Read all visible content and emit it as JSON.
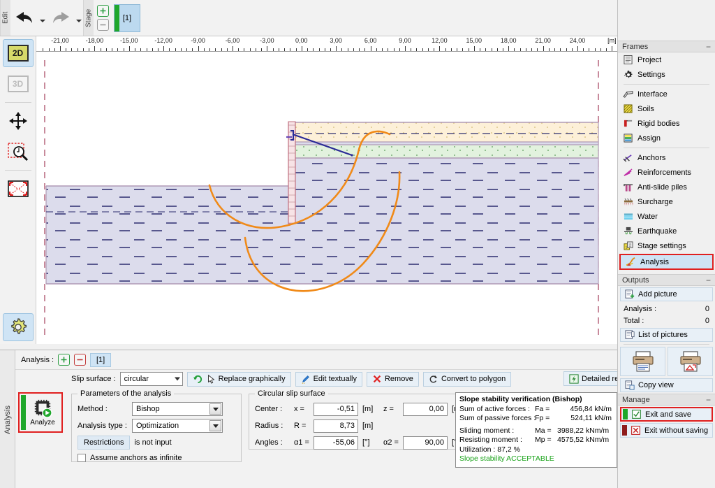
{
  "toolbar": {
    "edit_label": "Edit",
    "stage_label": "Stage",
    "undo_icon": "undo-arrow-icon",
    "redo_icon": "redo-arrow-icon",
    "stage_add_icon": "plus-icon",
    "stage_remove_icon": "minus-icon",
    "stage_tab_label": "[1]"
  },
  "left_tools": [
    {
      "name": "view-2d",
      "label": "2D",
      "active": true
    },
    {
      "name": "view-3d",
      "label": "3D",
      "active": false
    },
    {
      "name": "pan-tool",
      "label": "",
      "active": false
    },
    {
      "name": "zoom-window-tool",
      "label": "",
      "active": false
    },
    {
      "name": "zoom-fit-tool",
      "label": "",
      "active": false
    },
    {
      "name": "settings-tool",
      "label": "",
      "active": true
    }
  ],
  "ruler": {
    "unit": "[m]",
    "labels": [
      "-21,00",
      "-18,00",
      "-15,00",
      "-12,00",
      "-9,00",
      "-6,00",
      "-3,00",
      "0,00",
      "3,00",
      "6,00",
      "9,00",
      "12,00",
      "15,00",
      "18,00",
      "21,00",
      "24,00"
    ]
  },
  "drawing": {
    "soil_top_color": "#fdf0d8",
    "soil_mid_color": "#e2f2de",
    "soil_main_color": "#dcdcec",
    "slip_surface_color": "#f08a18",
    "anchor_color": "#2a2a96",
    "wall_color": "#f7e3e6",
    "boundary_color": "#b09ab5"
  },
  "bottom": {
    "vertical_tab": "Analysis",
    "analysis_label": "Analysis :",
    "analysis_add_icon": "plus-icon",
    "analysis_remove_icon": "minus-icon",
    "analysis_tab": "[1]",
    "analyze_button": "Analyze",
    "slip_surface_label": "Slip surface :",
    "slip_surface_value": "circular",
    "buttons": {
      "replace_graphically": "Replace graphically",
      "edit_textually": "Edit textually",
      "remove": "Remove",
      "convert_to_polygon": "Convert to polygon",
      "detailed_results": "Detailed results"
    },
    "params_group": "Parameters of the analysis",
    "method_label": "Method :",
    "method_value": "Bishop",
    "analysis_type_label": "Analysis type :",
    "analysis_type_value": "Optimization",
    "restrictions_button": "Restrictions",
    "restrictions_status": "is not input",
    "assume_anchors_label": "Assume anchors as infinite",
    "assume_anchors_checked": false,
    "circular_group": "Circular slip surface",
    "center_label": "Center :",
    "center_x_label": "x =",
    "center_x_value": "-0,51",
    "center_x_unit": "[m]",
    "center_z_label": "z =",
    "center_z_value": "0,00",
    "center_z_unit": "[m]",
    "radius_label": "Radius :",
    "radius_r_label": "R =",
    "radius_value": "8,73",
    "radius_unit": "[m]",
    "angles_label": "Angles :",
    "angle1_label": "α1 =",
    "angle1_value": "-55,06",
    "angle1_unit": "[°]",
    "angle2_label": "α2 =",
    "angle2_value": "90,00",
    "angle2_unit": "[°]"
  },
  "results": {
    "title": "Slope stability verification (Bishop)",
    "lines": [
      {
        "key": "Sum of active forces :",
        "sym": "Fa =",
        "val": "456,84 kN/m"
      },
      {
        "key": "Sum of passive forces :",
        "sym": "Fp =",
        "val": "524,11 kN/m"
      }
    ],
    "moments": [
      {
        "key": "Sliding moment :",
        "sym": "Ma =",
        "val": "3988,22 kNm/m"
      },
      {
        "key": "Resisting moment :",
        "sym": "Mp =",
        "val": "4575,52 kNm/m"
      }
    ],
    "utilization": "Utilization : 87,2 %",
    "status": "Slope stability ACCEPTABLE",
    "status_color": "#19a319"
  },
  "sidebar": {
    "frames_header": "Frames",
    "frames": [
      {
        "label": "Project",
        "icon": "document-icon",
        "group": 1
      },
      {
        "label": "Settings",
        "icon": "gear-icon",
        "group": 1
      },
      {
        "label": "Interface",
        "icon": "interface-icon",
        "group": 2
      },
      {
        "label": "Soils",
        "icon": "soils-icon",
        "group": 2
      },
      {
        "label": "Rigid bodies",
        "icon": "rigid-bodies-icon",
        "group": 2
      },
      {
        "label": "Assign",
        "icon": "assign-icon",
        "group": 2
      },
      {
        "label": "Anchors",
        "icon": "anchors-icon",
        "group": 3
      },
      {
        "label": "Reinforcements",
        "icon": "reinforcements-icon",
        "group": 3
      },
      {
        "label": "Anti-slide piles",
        "icon": "anti-slide-piles-icon",
        "group": 3
      },
      {
        "label": "Surcharge",
        "icon": "surcharge-icon",
        "group": 3
      },
      {
        "label": "Water",
        "icon": "water-icon",
        "group": 3
      },
      {
        "label": "Earthquake",
        "icon": "earthquake-icon",
        "group": 3
      },
      {
        "label": "Stage settings",
        "icon": "stage-settings-icon",
        "group": 3
      },
      {
        "label": "Analysis",
        "icon": "analysis-icon",
        "group": 3,
        "highlighted": true
      }
    ],
    "outputs_header": "Outputs",
    "add_picture": "Add picture",
    "analysis_count_label": "Analysis :",
    "analysis_count_value": "0",
    "total_count_label": "Total :",
    "total_count_value": "0",
    "list_of_pictures": "List of pictures",
    "print_icon": "print-document-icon",
    "print_preview_icon": "print-preview-icon",
    "copy_view": "Copy view",
    "manage_header": "Manage",
    "exit_and_save": "Exit and save",
    "exit_without_saving": "Exit without saving",
    "collapse_icon": "minus-icon"
  }
}
